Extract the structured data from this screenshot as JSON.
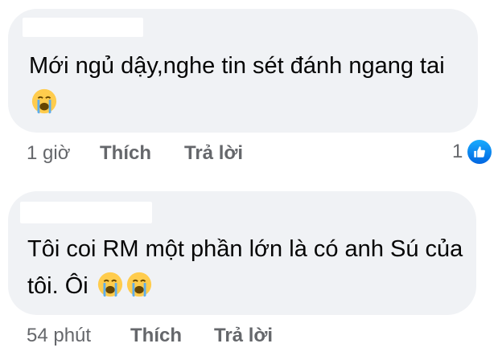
{
  "comments": [
    {
      "text": "Mới ngủ dậy,nghe tin sét đánh ngang tai",
      "emojis": [
        "loudly-crying-face"
      ],
      "time": "1 giờ",
      "like_label": "Thích",
      "reply_label": "Trả lời",
      "reaction_count": "1",
      "reaction_type": "like"
    },
    {
      "text": "Tôi coi RM một phần lớn là có anh Sú của tôi. Ôi",
      "emojis": [
        "loudly-crying-face",
        "loudly-crying-face"
      ],
      "time": "54 phút",
      "like_label": "Thích",
      "reply_label": "Trả lời"
    }
  ],
  "colors": {
    "bubble": "#f0f2f5",
    "text": "#050505",
    "meta": "#65676b",
    "like_blue": "#0165e1"
  }
}
